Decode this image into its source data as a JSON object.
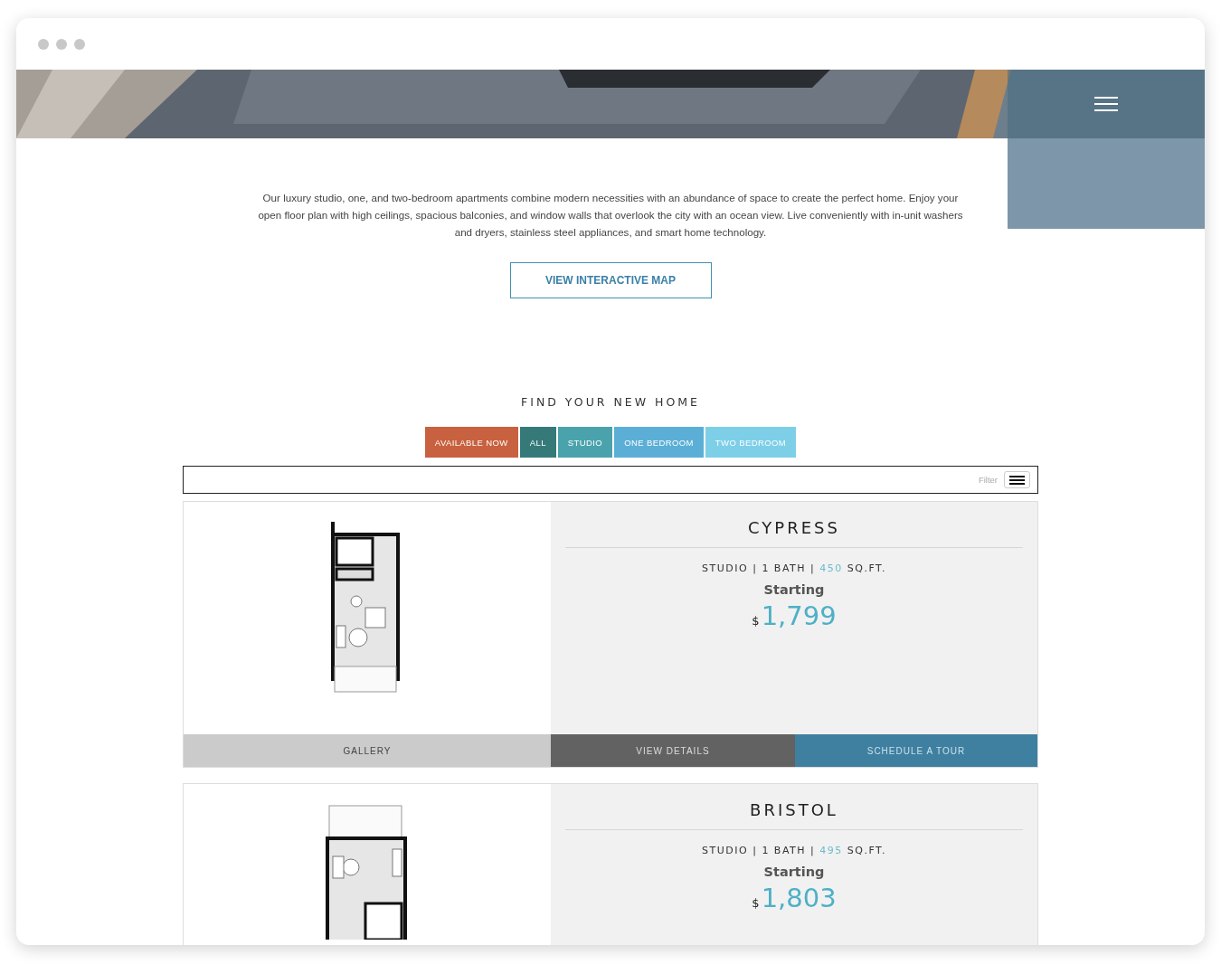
{
  "intro": "Our luxury studio, one, and two-bedroom apartments combine modern necessities with an abundance of space to create the perfect home. Enjoy your open floor plan with high ceilings, spacious balconies, and window walls that overlook the city with an ocean view. Live conveniently with in-unit washers and dryers, stainless steel appliances, and smart home technology.",
  "map_button": "VIEW INTERACTIVE MAP",
  "section_title": "FIND YOUR NEW HOME",
  "tabs": [
    {
      "label": "AVAILABLE NOW",
      "color": "#c8613f"
    },
    {
      "label": "ALL",
      "color": "#357a78"
    },
    {
      "label": "STUDIO",
      "color": "#4aa3ac"
    },
    {
      "label": "ONE BEDROOM",
      "color": "#5bafd6"
    },
    {
      "label": "TWO BEDROOM",
      "color": "#7dcfe8"
    }
  ],
  "filter": {
    "label": "Filter"
  },
  "separator": "|",
  "units": [
    {
      "name": "CYPRESS",
      "type": "STUDIO",
      "bath": "1 BATH",
      "sqft": "450",
      "sqft_unit": "SQ.FT.",
      "starting": "Starting",
      "currency": "$",
      "price": "1,799",
      "kind": "a",
      "buttons": [
        "GALLERY",
        "VIEW DETAILS",
        "SCHEDULE A TOUR"
      ]
    },
    {
      "name": "BRISTOL",
      "type": "STUDIO",
      "bath": "1 BATH",
      "sqft": "495",
      "sqft_unit": "SQ.FT.",
      "starting": "Starting",
      "currency": "$",
      "price": "1,803",
      "kind": "b"
    }
  ]
}
